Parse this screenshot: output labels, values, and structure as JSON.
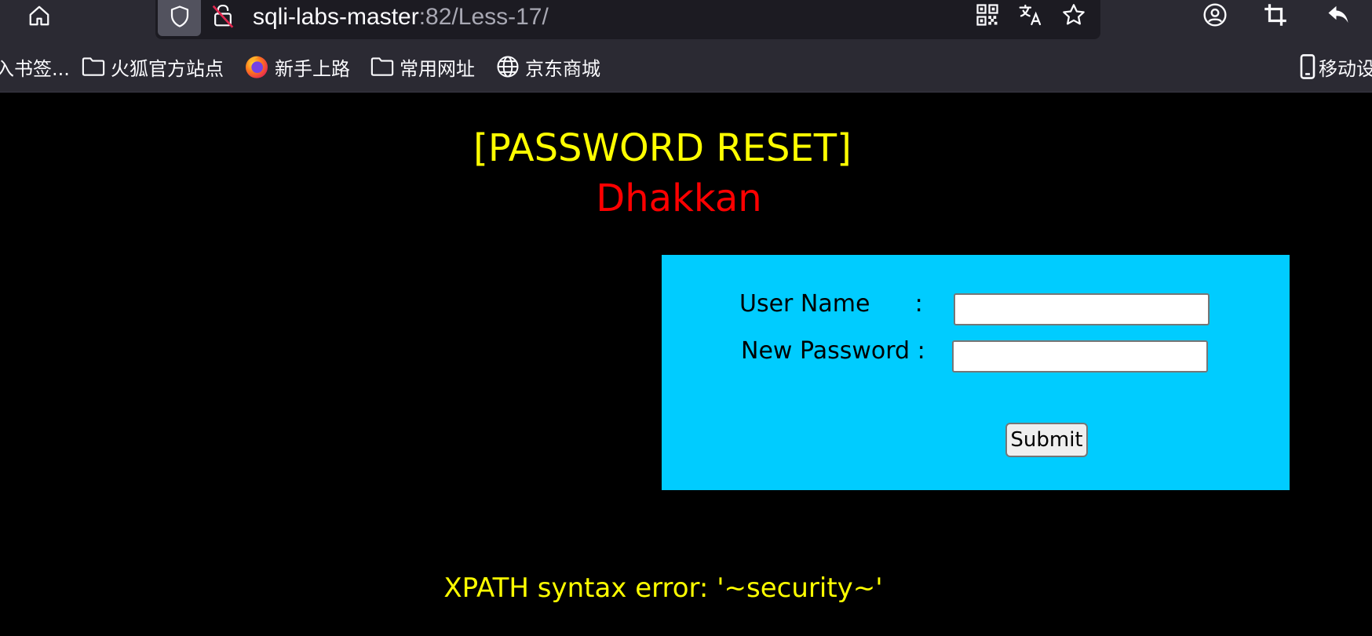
{
  "browser": {
    "url": {
      "host": "sqli-labs-master",
      "rest": ":82/Less-17/"
    },
    "icons": [
      "home-icon",
      "shield-icon",
      "insecure-lock-icon",
      "qr-code-icon",
      "translate-icon",
      "bookmark-star-icon",
      "account-icon",
      "crop-icon",
      "undo-icon"
    ],
    "bookmarks": [
      {
        "label": "入书签...",
        "icon": "none"
      },
      {
        "label": "火狐官方站点",
        "icon": "folder-icon"
      },
      {
        "label": "新手上路",
        "icon": "firefox-icon"
      },
      {
        "label": "常用网址",
        "icon": "folder-icon"
      },
      {
        "label": "京东商城",
        "icon": "globe-icon"
      },
      {
        "label": "移动设",
        "icon": "mobile-icon"
      }
    ]
  },
  "page": {
    "title": "[PASSWORD RESET]",
    "subtitle": "Dhakkan",
    "form": {
      "username_label": "User Name      :",
      "username_value": "",
      "password_label": "New Password :",
      "password_value": "",
      "submit_label": "Submit",
      "background": "#00ccff"
    },
    "message": "XPATH syntax error: '~security~'"
  },
  "colors": {
    "title": "#ffff00",
    "subtitle": "#ff0000",
    "message": "#ffff00",
    "page_background": "#000000",
    "chrome_background": "#2b2a33"
  }
}
